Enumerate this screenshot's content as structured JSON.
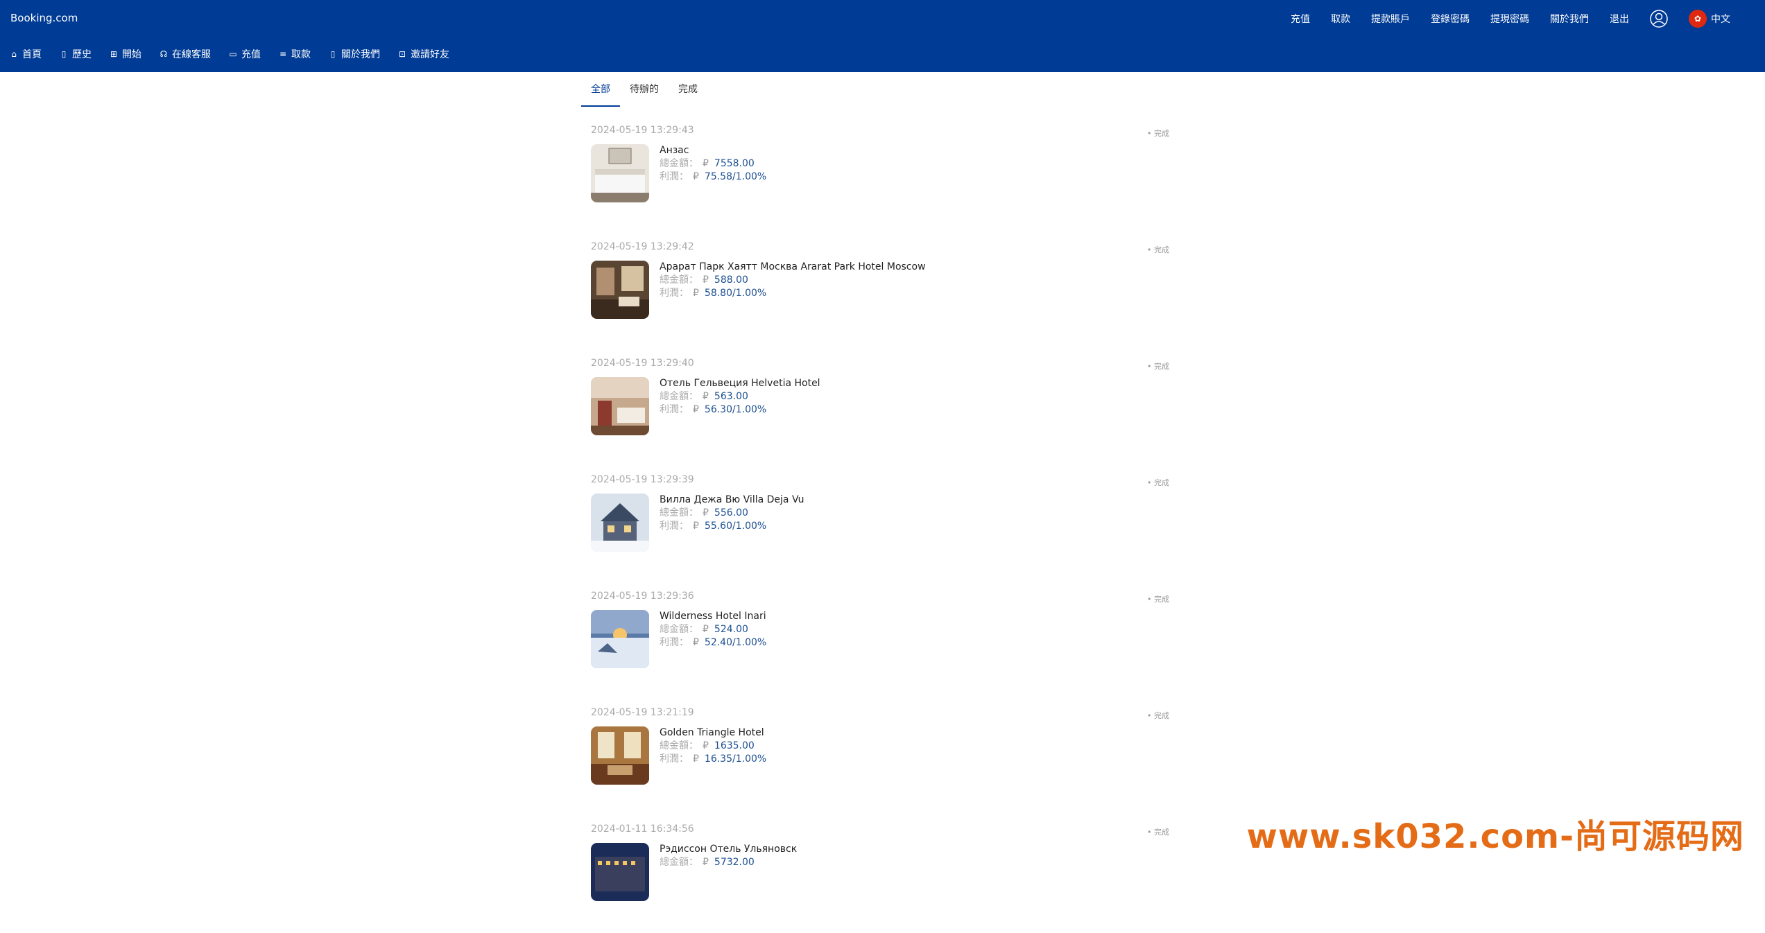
{
  "brand": "Booking.com",
  "top_menu": [
    "充值",
    "取款",
    "提款賬戶",
    "登錄密碼",
    "提現密碼",
    "關於我們",
    "退出"
  ],
  "language": "中文",
  "sub_nav": [
    {
      "label": "首頁",
      "icon": "home-icon"
    },
    {
      "label": "歷史",
      "icon": "document-icon"
    },
    {
      "label": "開始",
      "icon": "grid-icon"
    },
    {
      "label": "在線客服",
      "icon": "headset-icon"
    },
    {
      "label": "充值",
      "icon": "wallet-icon"
    },
    {
      "label": "取款",
      "icon": "database-icon"
    },
    {
      "label": "關於我們",
      "icon": "info-doc-icon"
    },
    {
      "label": "邀請好友",
      "icon": "gift-icon"
    }
  ],
  "tabs": [
    "全部",
    "待辦的",
    "完成"
  ],
  "labels": {
    "total": "總金額：",
    "profit": "利潤：",
    "currency": "₽"
  },
  "orders": [
    {
      "time": "2024-05-19 13:29:43",
      "status": "• 完成",
      "name": "Анзас",
      "total": "7558.00",
      "profit": "75.58/1.00%",
      "img": "bedroom"
    },
    {
      "time": "2024-05-19 13:29:42",
      "status": "• 完成",
      "name": "Арарат Парк Хаятт Москва Ararat Park Hotel Moscow",
      "total": "588.00",
      "profit": "58.80/1.00%",
      "img": "suite"
    },
    {
      "time": "2024-05-19 13:29:40",
      "status": "• 完成",
      "name": "Отель Гельвеция Helvetia Hotel",
      "total": "563.00",
      "profit": "56.30/1.00%",
      "img": "classic"
    },
    {
      "time": "2024-05-19 13:29:39",
      "status": "• 完成",
      "name": "Вилла Дежа Вю Villa Deja Vu",
      "total": "556.00",
      "profit": "55.60/1.00%",
      "img": "villa"
    },
    {
      "time": "2024-05-19 13:29:36",
      "status": "• 完成",
      "name": "Wilderness Hotel Inari",
      "total": "524.00",
      "profit": "52.40/1.00%",
      "img": "snow"
    },
    {
      "time": "2024-05-19 13:21:19",
      "status": "• 完成",
      "name": "Golden Triangle Hotel",
      "total": "1635.00",
      "profit": "16.35/1.00%",
      "img": "golden"
    },
    {
      "time": "2024-01-11 16:34:56",
      "status": "• 完成",
      "name": "Рэдиссон Отель Ульяновск",
      "total": "5732.00",
      "profit": "",
      "img": "night"
    }
  ],
  "watermark": "www.sk032.com-尚可源码网"
}
